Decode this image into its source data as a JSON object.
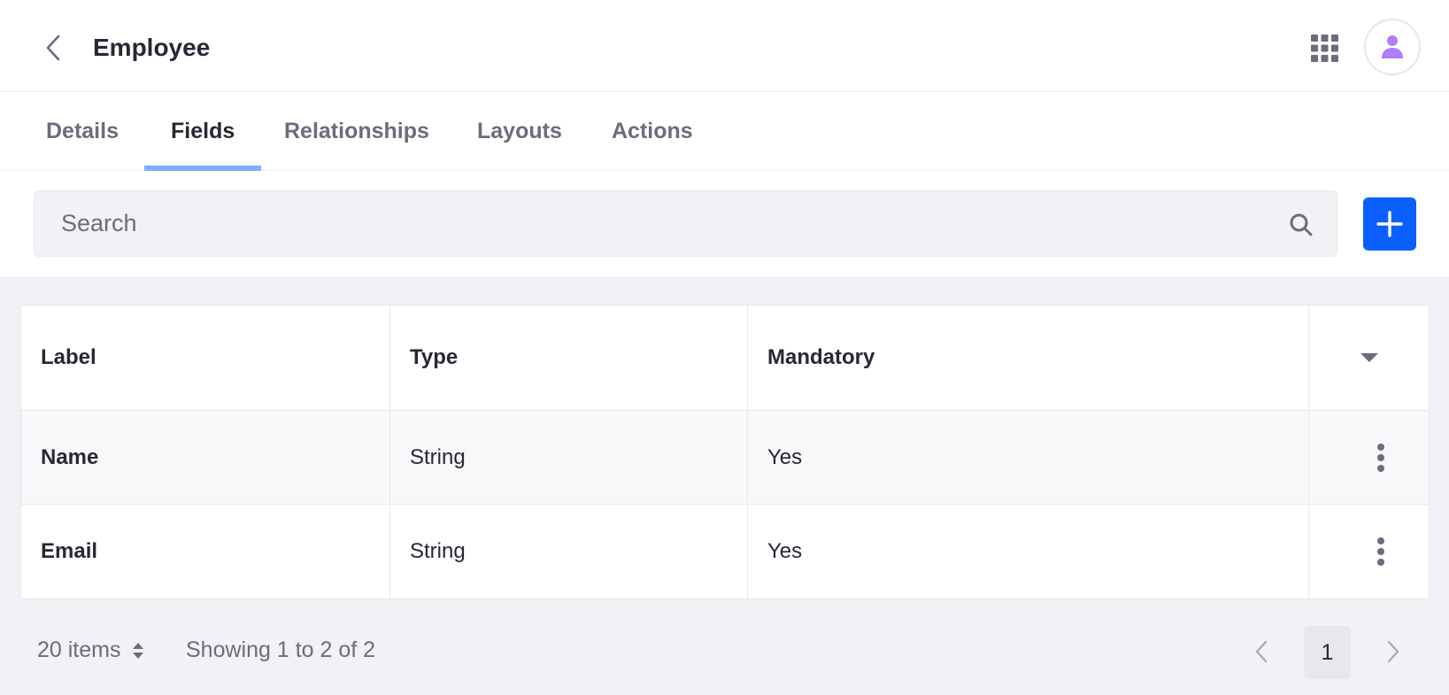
{
  "header": {
    "title": "Employee",
    "back_icon": "chevron-left-icon",
    "apps_icon": "grid-icon",
    "avatar_icon": "user-icon",
    "avatar_color": "#b07dfb"
  },
  "tabs": [
    {
      "label": "Details",
      "active": false
    },
    {
      "label": "Fields",
      "active": true
    },
    {
      "label": "Relationships",
      "active": false
    },
    {
      "label": "Layouts",
      "active": false
    },
    {
      "label": "Actions",
      "active": false
    }
  ],
  "toolbar": {
    "search_placeholder": "Search",
    "search_value": "",
    "add_button_icon": "plus-icon",
    "accent_color": "#0b5fff"
  },
  "table": {
    "columns": [
      "Label",
      "Type",
      "Mandatory"
    ],
    "rows": [
      {
        "label": "Name",
        "type": "String",
        "mandatory": "Yes"
      },
      {
        "label": "Email",
        "type": "String",
        "mandatory": "Yes"
      }
    ]
  },
  "footer": {
    "items_per_page": "20 items",
    "showing": "Showing 1 to 2 of 2",
    "current_page": "1"
  }
}
